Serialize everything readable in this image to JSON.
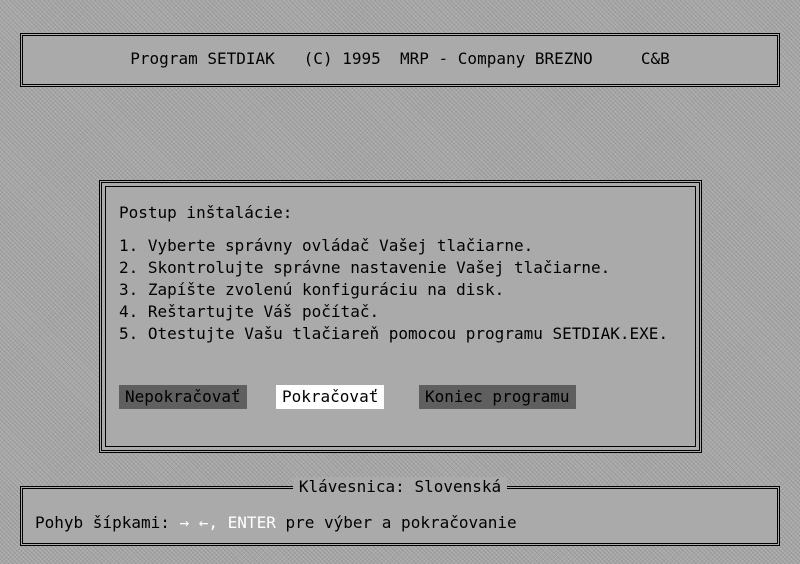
{
  "header": {
    "title": "Program SETDIAK   (C) 1995  MRP - Company BREZNO     C&B"
  },
  "dialog": {
    "heading": "Postup inštalácie:",
    "steps": [
      "1. Vyberte správny ovládač Vašej tlačiarne.",
      "2. Skontrolujte správne nastavenie Vašej tlačiarne.",
      "3. Zapíšte zvolenú konfiguráciu na disk.",
      "4. Reštartujte Váš počítač.",
      "5. Otestujte Vašu tlačiareň pomocou programu SETDIAK.EXE."
    ],
    "buttons": {
      "no": "Nepokračovať",
      "yes": "Pokračovať",
      "quit": "Koniec programu"
    },
    "selected": "yes"
  },
  "footer": {
    "keyboard_label": "Klávesnica:  Slovenská",
    "help_prefix": "Pohyb šípkami: ",
    "help_keys": "→ ←, ENTER",
    "help_suffix": " pre výber a pokračovanie"
  }
}
